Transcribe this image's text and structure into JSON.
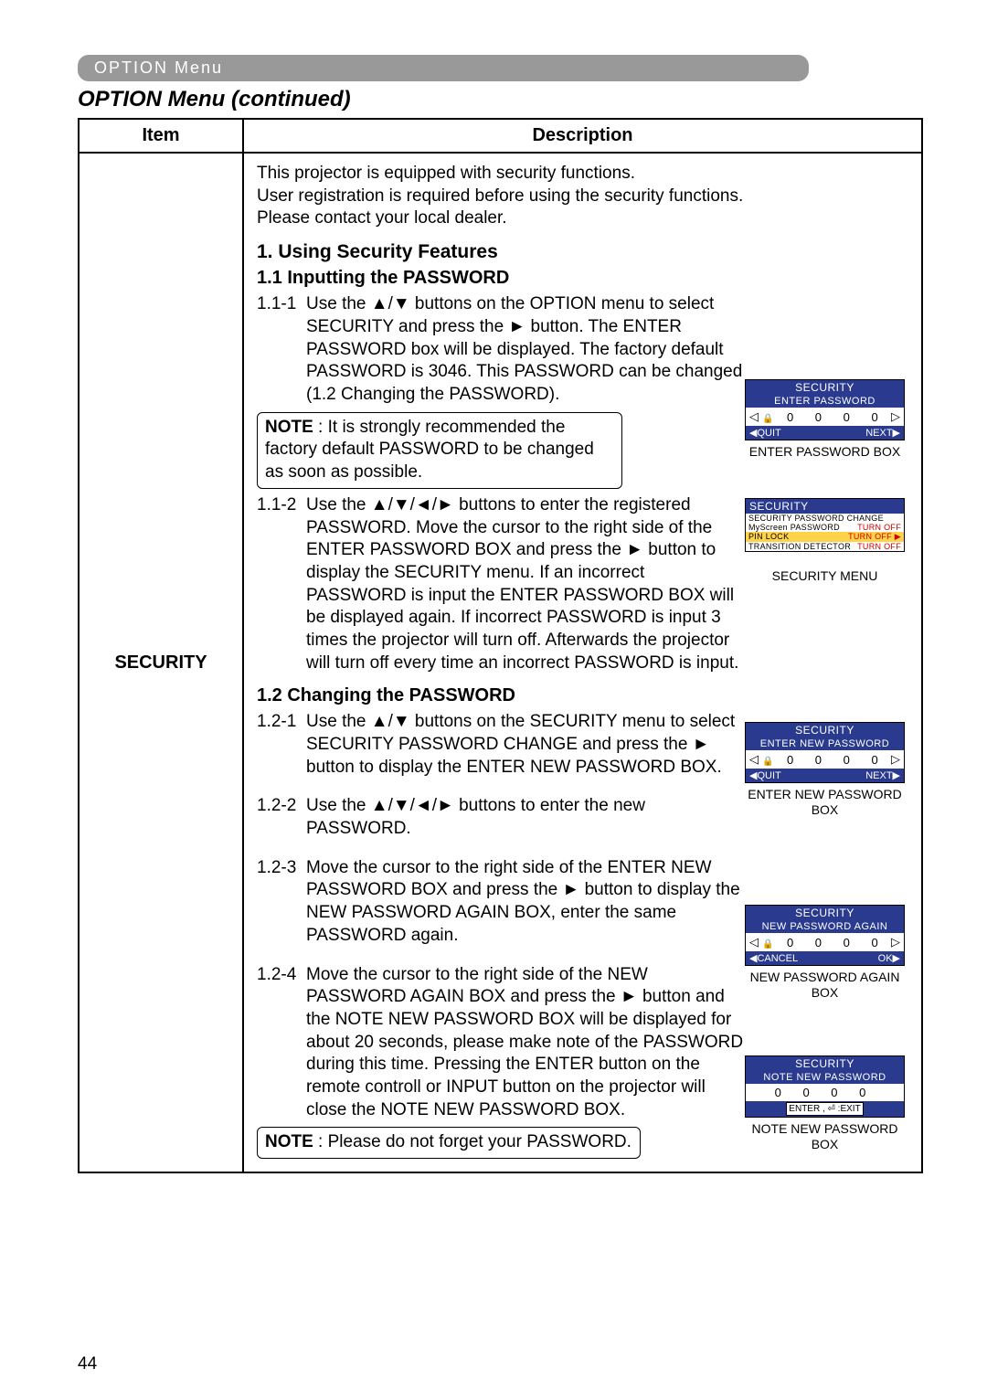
{
  "header": {
    "tab": "OPTION Menu",
    "title": "OPTION Menu (continued)"
  },
  "table": {
    "col_item": "Item",
    "col_desc": "Description",
    "item_name": "SECURITY"
  },
  "intro": "This projector is equipped with security functions.\nUser registration is required before using the security functions.\nPlease contact your local dealer.",
  "sec1": {
    "h1": "1. Using Security Features",
    "h2a": "1.1 Inputting the PASSWORD",
    "s111_num": "1.1-1",
    "s111": "Use the ▲/▼ buttons on the OPTION menu to select SECURITY and press the ► button. The ENTER PASSWORD box will be displayed. The factory default PASSWORD is 3046. This PASSWORD can be changed (1.2 Changing the PASSWORD).",
    "note1_label": "NOTE",
    "note1": " : It is strongly recommended the factory default PASSWORD to be changed as soon as possible.",
    "s112_num": "1.1-2",
    "s112": "Use the ▲/▼/◄/► buttons to enter the registered PASSWORD. Move the cursor to the right side of the ENTER PASSWORD BOX and press the ► button to display the SECURITY menu. If an incorrect PASSWORD is input the ENTER PASSWORD BOX will be displayed again. If incorrect PASSWORD is input 3 times the projector will turn off. Afterwards the projector will turn off every time an incorrect PASSWORD is input.",
    "h2b": "1.2 Changing the PASSWORD",
    "s121_num": "1.2-1",
    "s121": "Use the ▲/▼ buttons on the SECURITY menu to select SECURITY PASSWORD CHANGE and press the ► button to display the ENTER NEW PASSWORD BOX.",
    "s122_num": "1.2-2",
    "s122": "Use the ▲/▼/◄/► buttons to enter the new PASSWORD.",
    "s123_num": "1.2-3",
    "s123": "Move the cursor to the right side of the ENTER NEW PASSWORD BOX and press the ► button to display the NEW PASSWORD AGAIN BOX, enter the same PASSWORD again.",
    "s124_num": "1.2-4",
    "s124": "Move the cursor to the right side of the NEW PASSWORD AGAIN BOX and press the ► button and the NOTE NEW PASSWORD BOX will be displayed for about 20 seconds, please make note of the PASSWORD during this time. Pressing the ENTER button on the remote controll or INPUT button on the projector will close the NOTE NEW PASSWORD BOX.",
    "note2_label": "NOTE",
    "note2": " : Please do not forget your PASSWORD."
  },
  "osd": {
    "p1_head": "SECURITY",
    "p1_sub": "ENTER PASSWORD",
    "p1_digits": "0 0 0 0",
    "p1_left": "◀QUIT",
    "p1_right": "NEXT▶",
    "p1_cap": "ENTER PASSWORD BOX",
    "menu_head": "SECURITY",
    "menu_r1l": "SECURITY PASSWORD CHANGE",
    "menu_r2l": "MyScreen PASSWORD",
    "menu_r2r": "TURN OFF",
    "menu_r3l": "PIN LOCK",
    "menu_r3r": "TURN OFF ▶",
    "menu_r4l": "TRANSITION DETECTOR",
    "menu_r4r": "TURN OFF",
    "menu_cap": "SECURITY MENU",
    "p2_head": "SECURITY",
    "p2_sub": "ENTER NEW PASSWORD",
    "p2_digits": "0 0 0 0",
    "p2_left": "◀QUIT",
    "p2_right": "NEXT▶",
    "p2_cap": "ENTER NEW PASSWORD BOX",
    "p3_head": "SECURITY",
    "p3_sub": "NEW PASSWORD AGAIN",
    "p3_digits": "0 0 0 0",
    "p3_left": "◀CANCEL",
    "p3_right": "OK▶",
    "p3_cap": "NEW PASSWORD AGAIN BOX",
    "p4_head": "SECURITY",
    "p4_sub": "NOTE NEW PASSWORD",
    "p4_digits": "0 0 0 0",
    "p4_exit": "ENTER , ⏎ :EXIT",
    "p4_cap": "NOTE NEW PASSWORD BOX"
  },
  "page_number": "44"
}
